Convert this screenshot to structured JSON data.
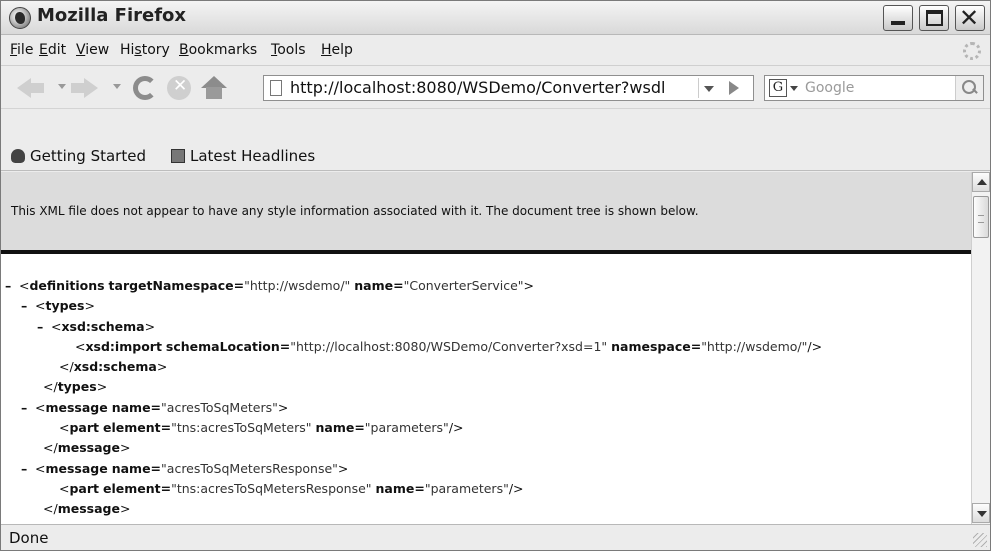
{
  "window": {
    "title": "Mozilla Firefox"
  },
  "menubar": {
    "items": [
      {
        "label": "File",
        "accel": "F",
        "rest": "ile"
      },
      {
        "label": "Edit",
        "accel": "E",
        "rest": "dit"
      },
      {
        "label": "View",
        "accel": "V",
        "rest": "iew"
      },
      {
        "label": "History",
        "pre": "Hi",
        "accel": "s",
        "rest": "tory"
      },
      {
        "label": "Bookmarks",
        "accel": "B",
        "rest": "ookmarks"
      },
      {
        "label": "Tools",
        "accel": "T",
        "rest": "ools"
      },
      {
        "label": "Help",
        "accel": "H",
        "rest": "elp"
      }
    ]
  },
  "navbar": {
    "url": "http://localhost:8080/WSDemo/Converter?wsdl",
    "search_placeholder": "Google",
    "search_engine_letter": "G"
  },
  "bookmarks": {
    "items": [
      {
        "label": "Getting Started",
        "icon": "getting-started-icon"
      },
      {
        "label": "Latest Headlines",
        "icon": "rss-icon"
      }
    ]
  },
  "content": {
    "header_text": "This XML file does not appear to have any style information associated with it. The document tree is shown below.",
    "xml_lines": [
      {
        "indent": 0,
        "collapse": true,
        "open": "<",
        "tag": "definitions",
        "attrs": [
          {
            "name": "targetNamespace",
            "value": "\"http://wsdemo/\""
          },
          {
            "name": "name",
            "value": "\"ConverterService\""
          }
        ],
        "close": ">"
      },
      {
        "indent": 1,
        "collapse": true,
        "open": "<",
        "tag": "types",
        "attrs": [],
        "close": ">"
      },
      {
        "indent": 2,
        "collapse": true,
        "open": "<",
        "tag": "xsd:schema",
        "attrs": [],
        "close": ">"
      },
      {
        "indent": 3,
        "collapse": false,
        "open": "<",
        "tag": "xsd:import",
        "attrs": [
          {
            "name": "schemaLocation",
            "value": "\"http://localhost:8080/WSDemo/Converter?xsd=1\""
          },
          {
            "name": "namespace",
            "value": "\"http://wsdemo/\""
          }
        ],
        "close": "/>"
      },
      {
        "indent": 2,
        "collapse": false,
        "open": "</",
        "tag": "xsd:schema",
        "attrs": [],
        "close": ">"
      },
      {
        "indent": 1,
        "collapse": false,
        "open": "</",
        "tag": "types",
        "attrs": [],
        "close": ">"
      },
      {
        "indent": 1,
        "collapse": true,
        "open": "<",
        "tag": "message",
        "attrs": [
          {
            "name": "name",
            "value": "\"acresToSqMeters\""
          }
        ],
        "close": ">"
      },
      {
        "indent": 2,
        "collapse": false,
        "open": "<",
        "tag": "part",
        "attrs": [
          {
            "name": "element",
            "value": "\"tns:acresToSqMeters\""
          },
          {
            "name": "name",
            "value": "\"parameters\""
          }
        ],
        "close": "/>"
      },
      {
        "indent": 1,
        "collapse": false,
        "open": "</",
        "tag": "message",
        "attrs": [],
        "close": ">"
      },
      {
        "indent": 1,
        "collapse": true,
        "open": "<",
        "tag": "message",
        "attrs": [
          {
            "name": "name",
            "value": "\"acresToSqMetersResponse\""
          }
        ],
        "close": ">"
      },
      {
        "indent": 2,
        "collapse": false,
        "open": "<",
        "tag": "part",
        "attrs": [
          {
            "name": "element",
            "value": "\"tns:acresToSqMetersResponse\""
          },
          {
            "name": "name",
            "value": "\"parameters\""
          }
        ],
        "close": "/>"
      },
      {
        "indent": 1,
        "collapse": false,
        "open": "</",
        "tag": "message",
        "attrs": [],
        "close": ">"
      }
    ]
  },
  "statusbar": {
    "text": "Done"
  }
}
